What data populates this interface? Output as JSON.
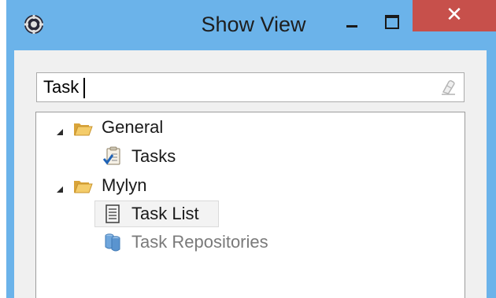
{
  "window": {
    "title": "Show View",
    "close_glyph": "✕"
  },
  "filter": {
    "value": "Task"
  },
  "tree": {
    "categories": [
      {
        "label": "General",
        "icon": "folder-open-icon",
        "items": [
          {
            "label": "Tasks",
            "icon": "tasks-icon",
            "enabled": true,
            "selected": false
          }
        ]
      },
      {
        "label": "Mylyn",
        "icon": "folder-open-icon",
        "items": [
          {
            "label": "Task List",
            "icon": "task-list-icon",
            "enabled": true,
            "selected": true
          },
          {
            "label": "Task Repositories",
            "icon": "task-repositories-icon",
            "enabled": false,
            "selected": false
          }
        ]
      }
    ]
  },
  "colors": {
    "titlebar": "#6bb3ea",
    "close_button": "#c7504b",
    "folder": "#e8b64a",
    "disabled_text": "#7a7a7a"
  }
}
